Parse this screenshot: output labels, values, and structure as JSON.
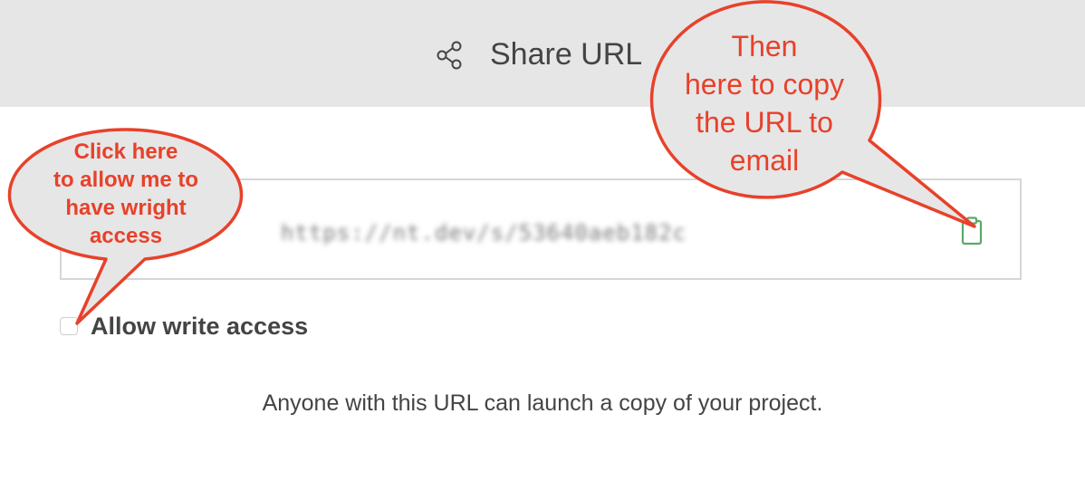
{
  "header": {
    "title": "Share URL",
    "icon": "share-icon"
  },
  "share": {
    "url": "https://nt.dev/s/53640aeb182c",
    "copy_icon": "clipboard-icon",
    "allow_write_label": "Allow write access",
    "allow_write_checked": false,
    "info_text": "Anyone with this URL can launch a copy of your project."
  },
  "annotations": {
    "left": "Click here\nto allow me to\nhave wright\naccess",
    "right": "Then\nhere to copy\nthe URL to\nemail"
  },
  "colors": {
    "header_bg": "#e6e6e6",
    "callout_red": "#e8412a",
    "callout_fill": "#e6e6e6",
    "copy_icon_green": "#5aa86a"
  }
}
